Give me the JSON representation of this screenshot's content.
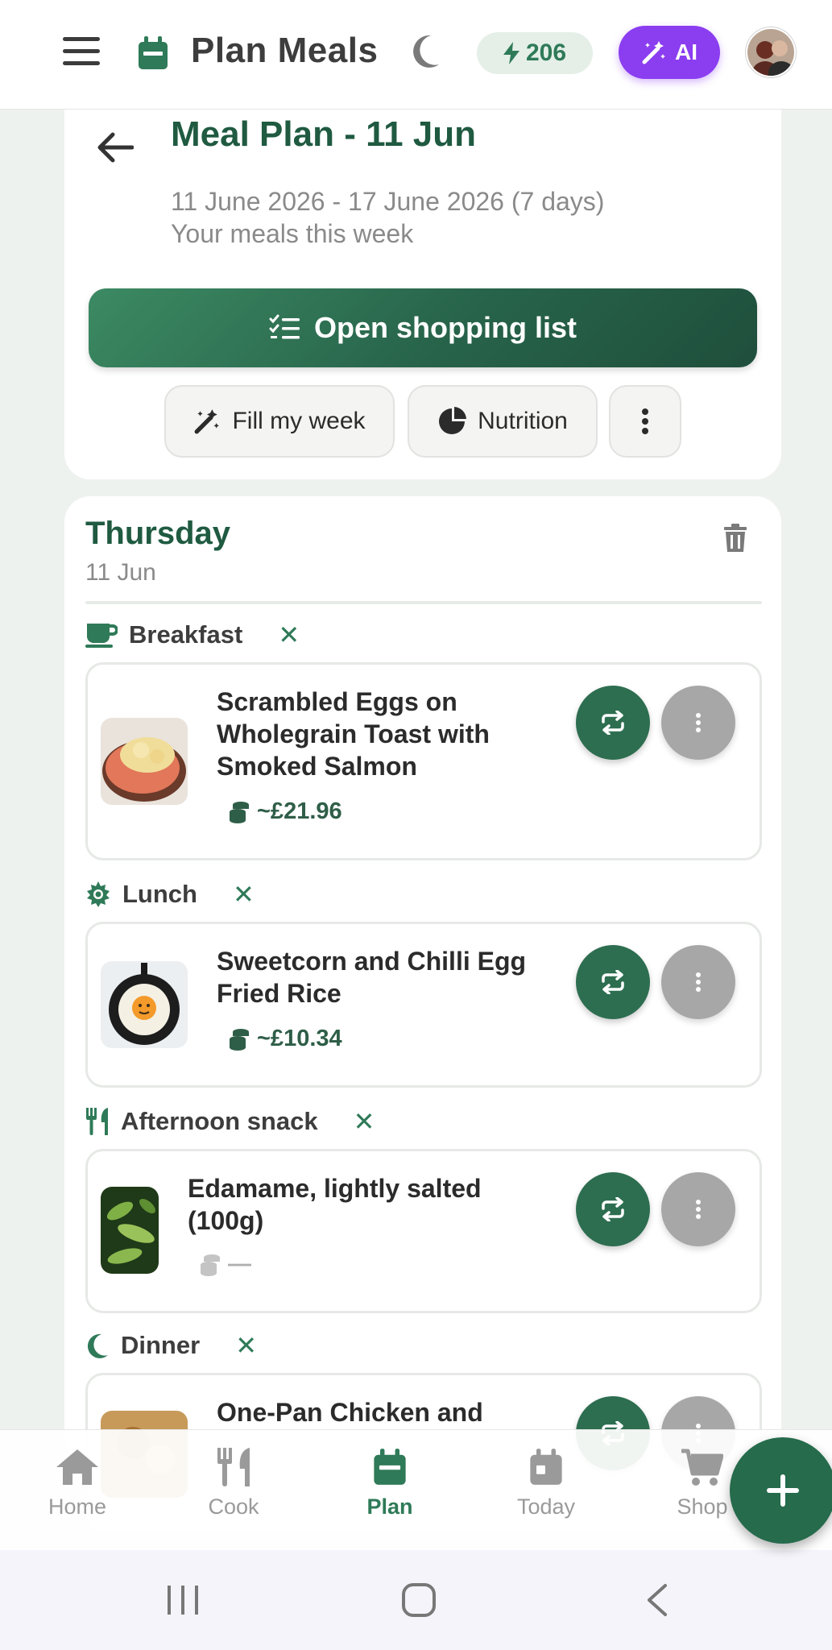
{
  "header": {
    "title": "Plan Meals",
    "energy_count": "206",
    "ai_label": "AI"
  },
  "plan": {
    "title": "Meal Plan - 11 Jun",
    "date_range": "11 June 2026 - 17 June 2026 (7 days)",
    "subtitle": "Your meals this week",
    "shopping_label": "Open shopping list",
    "fill_week_label": "Fill my week",
    "nutrition_label": "Nutrition"
  },
  "day": {
    "name": "Thursday",
    "date": "11 Jun",
    "slots": [
      {
        "label": "Breakfast",
        "meal": "Scrambled Eggs on Wholegrain Toast with Smoked Salmon",
        "cost": "~£21.96"
      },
      {
        "label": "Lunch",
        "meal": "Sweetcorn and Chilli Egg Fried Rice",
        "cost": "~£10.34"
      },
      {
        "label": "Afternoon snack",
        "meal": "Edamame, lightly salted (100g)",
        "cost": "—"
      },
      {
        "label": "Dinner",
        "meal": "One-Pan Chicken and",
        "cost": ""
      }
    ]
  },
  "bottom_nav": {
    "items": [
      {
        "label": "Home",
        "icon": "home-icon"
      },
      {
        "label": "Cook",
        "icon": "utensils-icon"
      },
      {
        "label": "Plan",
        "icon": "calendar-icon",
        "active": true
      },
      {
        "label": "Today",
        "icon": "calendar-day-icon"
      },
      {
        "label": "Shop",
        "icon": "cart-icon"
      }
    ]
  },
  "colors": {
    "brand_green": "#1f5a41",
    "accent_green": "#2f7a58",
    "ai_purple": "#8b3df0",
    "energy_bg": "#e5efe8"
  }
}
